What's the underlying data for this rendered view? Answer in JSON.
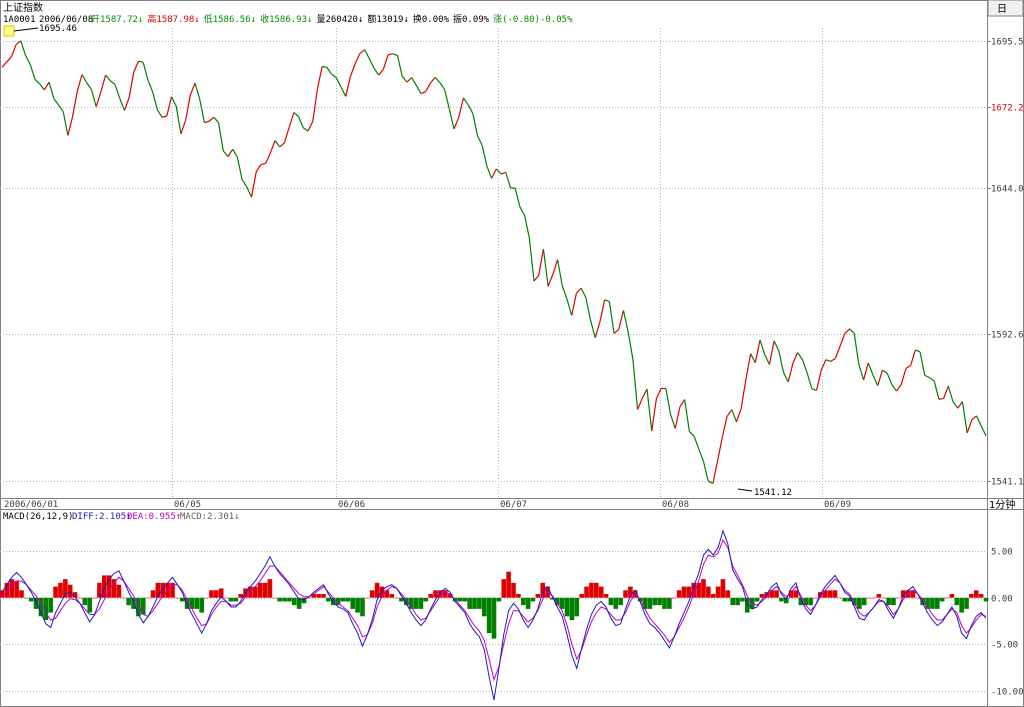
{
  "header": {
    "title": "上证指数",
    "code": "1A0001",
    "date": "2006/06/08",
    "items": [
      {
        "text": "开1587.72↓",
        "color": "#009000"
      },
      {
        "text": "高1587.98↓",
        "color": "#e00000"
      },
      {
        "text": "低1586.56↓",
        "color": "#009000"
      },
      {
        "text": "收1586.93↓",
        "color": "#009000"
      },
      {
        "text": "量260420↓",
        "color": "#000000"
      },
      {
        "text": "额13019↓",
        "color": "#000000"
      },
      {
        "text": "换0.00%",
        "color": "#000000"
      },
      {
        "text": "振0.09%",
        "color": "#000000"
      },
      {
        "text": "涨(-0.80)-0.05%",
        "color": "#009000"
      }
    ]
  },
  "corner_tab": "日",
  "period_tab": "1分钟",
  "macd_header": {
    "name": "MACD(26,12,9)",
    "diff": "DIFF:2.105↑",
    "dea": "DEA:0.955↑",
    "macd": "MACD:2.301↓",
    "diff_color": "#1e1ebe",
    "dea_color": "#c000c0",
    "macd_color": "#606060"
  },
  "colors": {
    "up": "#e00000",
    "down": "#008000",
    "diff": "#1e1ebe",
    "dea": "#c000c0",
    "grid": "#b4b4b4",
    "axis": "#808080"
  },
  "chart_data": [
    {
      "type": "line",
      "name": "price",
      "x_labels": [
        "2006/06/01",
        "06/05",
        "06/06",
        "06/07",
        "06/08",
        "06/09"
      ],
      "y_ticks": [
        "1695.5",
        "1672.2",
        "1644.0",
        "1592.6",
        "1541.1"
      ],
      "y_highlight": "1672.2",
      "ylim": [
        1538,
        1700
      ],
      "high_label": "1695.46",
      "low_label": "1541.12",
      "price": [
        1686.2,
        1688.1,
        1689.9,
        1694.2,
        1695.5,
        1690.4,
        1687.2,
        1682.0,
        1680.4,
        1678.3,
        1681.0,
        1675.3,
        1673.0,
        1670.7,
        1662.3,
        1669.0,
        1677.9,
        1683.7,
        1680.8,
        1678.4,
        1672.4,
        1677.6,
        1683.5,
        1681.5,
        1680.2,
        1675.4,
        1671.1,
        1675.6,
        1684.6,
        1688.4,
        1687.9,
        1681.7,
        1677.6,
        1671.3,
        1668.7,
        1669.1,
        1675.9,
        1672.6,
        1662.9,
        1667.6,
        1676.5,
        1680.7,
        1675.0,
        1666.8,
        1667.3,
        1668.7,
        1666.8,
        1656.9,
        1654.9,
        1657.5,
        1654.7,
        1646.8,
        1644.3,
        1640.7,
        1649.6,
        1652.1,
        1652.5,
        1656.2,
        1660.5,
        1658.3,
        1659.8,
        1665.2,
        1670.4,
        1668.9,
        1665.0,
        1663.9,
        1667.2,
        1678.7,
        1686.5,
        1686.2,
        1683.8,
        1682.6,
        1679.3,
        1676.0,
        1683.0,
        1687.4,
        1691.0,
        1692.4,
        1689.3,
        1686.0,
        1683.5,
        1685.5,
        1690.6,
        1691.0,
        1690.4,
        1683.1,
        1681.0,
        1682.6,
        1679.9,
        1677.0,
        1677.7,
        1680.7,
        1682.7,
        1680.9,
        1678.5,
        1671.7,
        1664.6,
        1668.6,
        1675.5,
        1673.1,
        1670.0,
        1662.2,
        1658.8,
        1651.5,
        1647.3,
        1650.6,
        1648.8,
        1649.4,
        1644.0,
        1643.8,
        1637.3,
        1634.3,
        1626.4,
        1611.3,
        1613.2,
        1622.5,
        1609.4,
        1613.6,
        1618.8,
        1609.6,
        1604.9,
        1599.2,
        1607.0,
        1608.8,
        1605.5,
        1597.6,
        1591.4,
        1597.0,
        1604.7,
        1604.1,
        1592.9,
        1594.3,
        1601.0,
        1593.4,
        1583.9,
        1566.2,
        1570.2,
        1573.4,
        1558.7,
        1570.1,
        1573.6,
        1573.6,
        1564.5,
        1559.6,
        1567.2,
        1569.7,
        1558.5,
        1556.9,
        1552.3,
        1548.0,
        1541.1,
        1540.3,
        1548.4,
        1556.5,
        1563.8,
        1566.2,
        1561.9,
        1566.6,
        1576.8,
        1585.8,
        1582.6,
        1590.6,
        1585.5,
        1582.0,
        1590.3,
        1586.7,
        1579.2,
        1575.9,
        1582.5,
        1586.2,
        1583.8,
        1579.1,
        1573.5,
        1572.9,
        1580.0,
        1583.7,
        1583.1,
        1584.1,
        1588.4,
        1592.8,
        1594.5,
        1593.0,
        1582.0,
        1576.6,
        1582.6,
        1578.2,
        1574.6,
        1580.0,
        1579.0,
        1575.0,
        1572.7,
        1575.0,
        1580.6,
        1581.7,
        1587.1,
        1586.4,
        1578.2,
        1577.4,
        1576.2,
        1569.8,
        1570.1,
        1574.4,
        1568.9,
        1566.7,
        1569.0,
        1558.0,
        1562.6,
        1564.0,
        1560.4,
        1557.0
      ]
    },
    {
      "type": "bar",
      "name": "MACD",
      "ylim": [
        -11,
        7.5
      ],
      "y_ticks": [
        "5.00",
        "0.00",
        "-5.00",
        "-10.00"
      ],
      "y_tick_values": [
        5,
        0,
        -5,
        -10
      ],
      "diff": [
        0.6,
        1.4,
        2.2,
        2.7,
        2.2,
        1.4,
        0.6,
        -0.4,
        -1.6,
        -2.8,
        -3.2,
        -1.6,
        -0.6,
        0.4,
        0.6,
        0.1,
        -0.6,
        -1.6,
        -2.6,
        -1.8,
        -0.4,
        1.0,
        2.0,
        2.6,
        2.9,
        1.8,
        0.6,
        -0.4,
        -1.8,
        -2.7,
        -2.0,
        -1.0,
        0.2,
        1.0,
        1.6,
        2.2,
        1.4,
        0.6,
        -0.8,
        -1.8,
        -2.8,
        -3.8,
        -2.8,
        -1.4,
        -0.6,
        0.1,
        -0.4,
        -1.0,
        -1.0,
        -0.4,
        0.6,
        1.2,
        1.8,
        2.6,
        3.4,
        4.4,
        3.4,
        2.6,
        2.0,
        1.4,
        0.6,
        -0.2,
        -0.2,
        0.1,
        0.6,
        1.0,
        1.4,
        0.4,
        -0.4,
        -1.0,
        -1.2,
        -1.6,
        -2.8,
        -3.8,
        -5.2,
        -4.0,
        -2.4,
        -0.2,
        0.8,
        1.2,
        1.4,
        1.0,
        0.2,
        -0.6,
        -1.6,
        -2.4,
        -3.0,
        -2.4,
        -1.2,
        -0.2,
        0.6,
        1.0,
        0.6,
        -0.4,
        -1.0,
        -1.6,
        -2.8,
        -3.6,
        -4.2,
        -5.6,
        -8.5,
        -11.0,
        -7.6,
        -4.0,
        -1.4,
        -0.6,
        -1.2,
        -2.4,
        -3.2,
        -2.4,
        -1.2,
        0.6,
        1.2,
        0.1,
        -1.0,
        -2.0,
        -4.0,
        -6.2,
        -7.6,
        -5.4,
        -3.4,
        -1.8,
        -0.8,
        -0.4,
        -1.0,
        -2.2,
        -3.0,
        -2.8,
        -1.2,
        0.2,
        0.8,
        -0.4,
        -1.8,
        -2.8,
        -3.2,
        -3.8,
        -4.6,
        -5.4,
        -4.2,
        -2.8,
        -1.6,
        -0.4,
        1.2,
        2.6,
        4.6,
        5.2,
        4.6,
        5.4,
        7.2,
        5.8,
        3.0,
        2.0,
        1.2,
        -0.6,
        -1.2,
        -1.0,
        -0.2,
        0.4,
        1.2,
        1.6,
        0.4,
        -0.2,
        1.0,
        1.6,
        -0.2,
        -1.2,
        -1.8,
        -0.8,
        0.4,
        1.2,
        1.8,
        2.4,
        1.6,
        0.6,
        0.2,
        -1.0,
        -2.2,
        -2.4,
        -1.6,
        -1.0,
        -0.2,
        -0.4,
        -1.4,
        -2.2,
        -1.2,
        0.2,
        0.8,
        1.2,
        0.4,
        -0.6,
        -1.6,
        -2.4,
        -3.0,
        -2.6,
        -1.8,
        -1.0,
        -2.0,
        -3.8,
        -4.4,
        -3.0,
        -2.0,
        -1.6,
        -2.2
      ],
      "dea": [
        0.2,
        0.6,
        1.2,
        1.8,
        1.8,
        1.4,
        0.8,
        0.2,
        -0.6,
        -1.6,
        -2.4,
        -2.2,
        -1.4,
        -0.6,
        -0.1,
        -0.2,
        -0.6,
        -1.2,
        -1.8,
        -1.8,
        -1.2,
        -0.2,
        0.8,
        1.6,
        2.2,
        1.8,
        1.0,
        0.2,
        -0.8,
        -1.8,
        -2.0,
        -1.4,
        -0.6,
        0.2,
        0.8,
        1.4,
        1.4,
        0.8,
        -0.2,
        -1.2,
        -2.2,
        -3.0,
        -2.8,
        -1.8,
        -1.0,
        -0.4,
        -0.4,
        -0.8,
        -0.8,
        -0.6,
        0.1,
        0.6,
        1.2,
        1.8,
        2.6,
        3.4,
        3.4,
        2.8,
        2.2,
        1.6,
        1.0,
        0.4,
        0.1,
        0.1,
        0.4,
        0.8,
        1.2,
        0.6,
        0.0,
        -0.6,
        -1.0,
        -1.4,
        -2.2,
        -3.0,
        -4.2,
        -4.0,
        -2.8,
        -1.0,
        0.2,
        0.8,
        1.2,
        1.0,
        0.4,
        -0.2,
        -1.0,
        -1.8,
        -2.4,
        -2.2,
        -1.4,
        -0.6,
        0.2,
        0.6,
        0.4,
        -0.2,
        -0.8,
        -1.4,
        -2.2,
        -3.0,
        -3.6,
        -4.6,
        -6.6,
        -8.8,
        -7.4,
        -5.0,
        -2.8,
        -1.4,
        -1.4,
        -2.0,
        -2.6,
        -2.2,
        -1.4,
        -0.2,
        0.6,
        0.2,
        -0.6,
        -1.4,
        -3.0,
        -5.0,
        -6.6,
        -5.6,
        -4.0,
        -2.6,
        -1.6,
        -1.0,
        -1.2,
        -1.8,
        -2.4,
        -2.4,
        -1.6,
        -0.4,
        0.4,
        -0.2,
        -1.2,
        -2.2,
        -2.8,
        -3.4,
        -4.0,
        -4.8,
        -4.2,
        -3.2,
        -2.2,
        -1.0,
        0.4,
        1.8,
        3.6,
        4.6,
        4.4,
        4.8,
        6.2,
        5.4,
        3.4,
        2.4,
        1.4,
        0.2,
        -0.6,
        -0.8,
        -0.4,
        0.1,
        0.8,
        1.2,
        0.6,
        0.1,
        0.6,
        1.2,
        0.2,
        -0.8,
        -1.4,
        -0.8,
        0.1,
        0.8,
        1.4,
        2.0,
        1.6,
        0.8,
        0.4,
        -0.6,
        -1.6,
        -2.0,
        -1.6,
        -1.0,
        -0.4,
        -0.4,
        -1.0,
        -1.8,
        -1.2,
        -0.2,
        0.4,
        0.8,
        0.4,
        -0.2,
        -1.0,
        -1.8,
        -2.4,
        -2.4,
        -1.8,
        -1.2,
        -1.6,
        -3.0,
        -3.8,
        -3.2,
        -2.4,
        -1.8,
        -2.0
      ],
      "macd": [
        0.8,
        1.6,
        2.0,
        1.8,
        0.8,
        0.0,
        -0.4,
        -1.2,
        -2.0,
        -2.4,
        -1.6,
        1.2,
        1.6,
        2.0,
        1.4,
        0.6,
        0.0,
        -0.8,
        -1.6,
        0.0,
        1.6,
        2.4,
        2.4,
        2.0,
        1.4,
        0.0,
        -0.8,
        -1.2,
        -2.0,
        -1.8,
        0.0,
        0.8,
        1.6,
        1.6,
        1.6,
        1.6,
        0.0,
        -0.4,
        -1.2,
        -1.2,
        -1.2,
        -1.6,
        0.0,
        0.8,
        0.8,
        1.0,
        0.0,
        -0.4,
        -0.4,
        0.4,
        1.0,
        1.2,
        1.2,
        1.6,
        1.6,
        2.0,
        0.0,
        -0.4,
        -0.4,
        -0.4,
        -0.8,
        -1.2,
        -0.6,
        0.0,
        0.4,
        0.4,
        0.4,
        -0.4,
        -0.8,
        -0.8,
        -0.4,
        -0.4,
        -1.2,
        -1.6,
        -2.0,
        0.0,
        0.8,
        1.6,
        1.2,
        0.8,
        0.4,
        0.0,
        -0.4,
        -0.8,
        -1.2,
        -1.2,
        -1.2,
        -0.4,
        0.4,
        0.8,
        0.8,
        0.8,
        0.4,
        -0.4,
        -0.4,
        -0.4,
        -1.2,
        -1.2,
        -1.2,
        -2.0,
        -3.8,
        -4.4,
        -0.4,
        2.0,
        2.8,
        1.6,
        0.4,
        -0.8,
        -1.2,
        -0.4,
        0.4,
        1.6,
        1.2,
        -0.2,
        -0.8,
        -1.2,
        -2.0,
        -2.4,
        -2.0,
        0.4,
        1.2,
        1.6,
        1.6,
        1.2,
        0.4,
        -0.8,
        -1.2,
        -0.8,
        0.8,
        1.2,
        0.8,
        -0.4,
        -1.2,
        -1.2,
        -0.8,
        -0.8,
        -1.2,
        -1.2,
        0.0,
        0.8,
        1.2,
        1.2,
        1.6,
        1.6,
        2.0,
        1.2,
        0.4,
        1.2,
        2.0,
        0.8,
        -0.8,
        -0.8,
        -0.4,
        -1.6,
        -1.2,
        -0.4,
        0.4,
        0.6,
        0.8,
        0.8,
        -0.4,
        -0.6,
        0.8,
        0.8,
        -0.8,
        -0.8,
        -0.8,
        0.0,
        0.6,
        0.8,
        0.8,
        0.8,
        0.0,
        -0.4,
        -0.4,
        -0.8,
        -1.2,
        -0.8,
        0.0,
        0.0,
        0.4,
        0.0,
        -0.8,
        -0.8,
        0.0,
        0.8,
        0.8,
        0.8,
        0.0,
        -0.8,
        -1.2,
        -1.2,
        -1.2,
        -0.4,
        0.0,
        0.4,
        -0.8,
        -1.6,
        -1.2,
        0.4,
        0.8,
        0.4,
        -0.4
      ]
    }
  ]
}
